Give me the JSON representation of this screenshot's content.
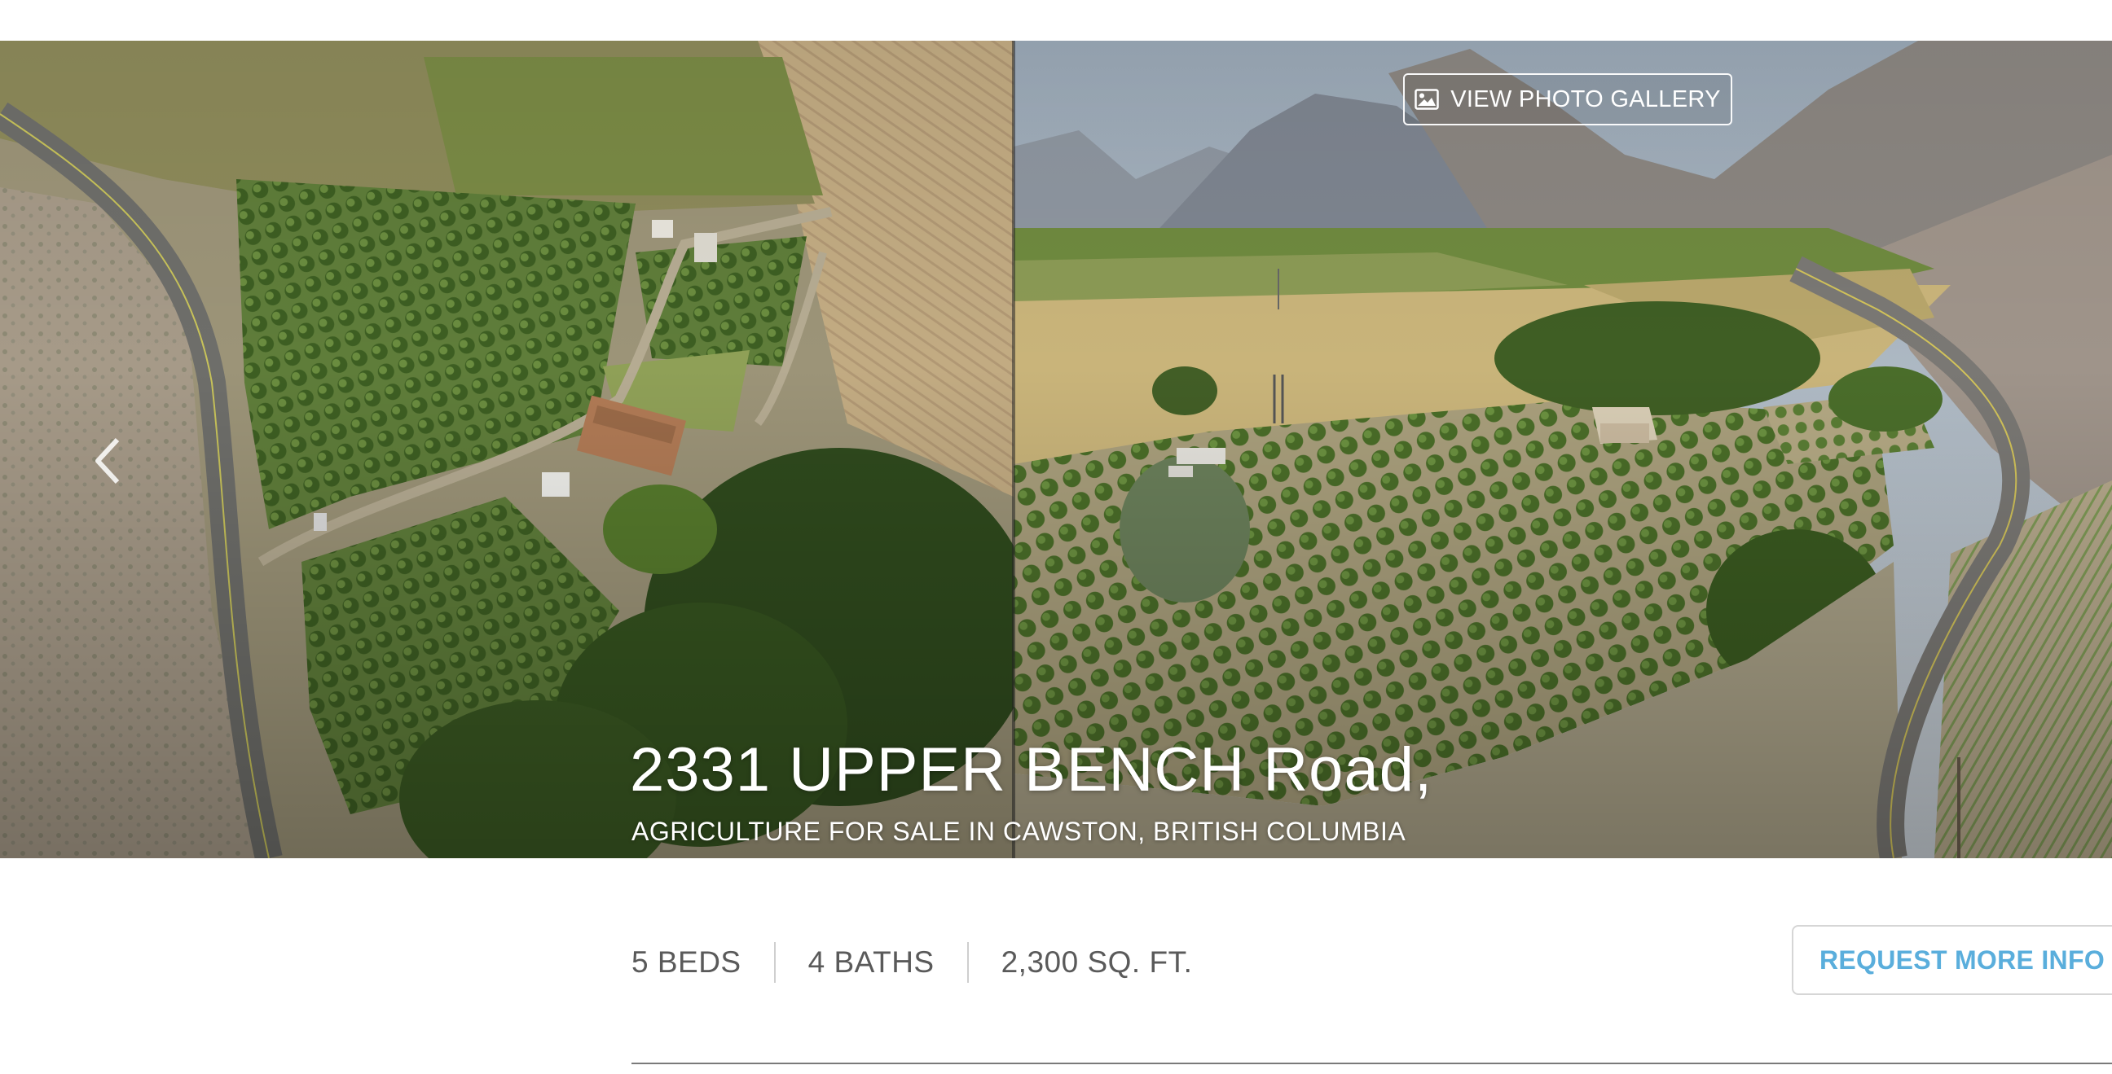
{
  "hero": {
    "gallery_button_label": "VIEW PHOTO GALLERY",
    "gallery_icon": "image-icon",
    "prev_icon": "chevron-left-icon",
    "title": "2331 UPPER BENCH Road,",
    "subtitle": "AGRICULTURE FOR SALE IN CAWSTON, BRITISH COLUMBIA"
  },
  "stats": {
    "beds": "5 BEDS",
    "baths": "4 BATHS",
    "area": "2,300 SQ. FT."
  },
  "cta": {
    "request_label": "REQUEST MORE INFO"
  },
  "colors": {
    "accent": "#5aaedc",
    "stat_text": "#5a5a5a"
  }
}
